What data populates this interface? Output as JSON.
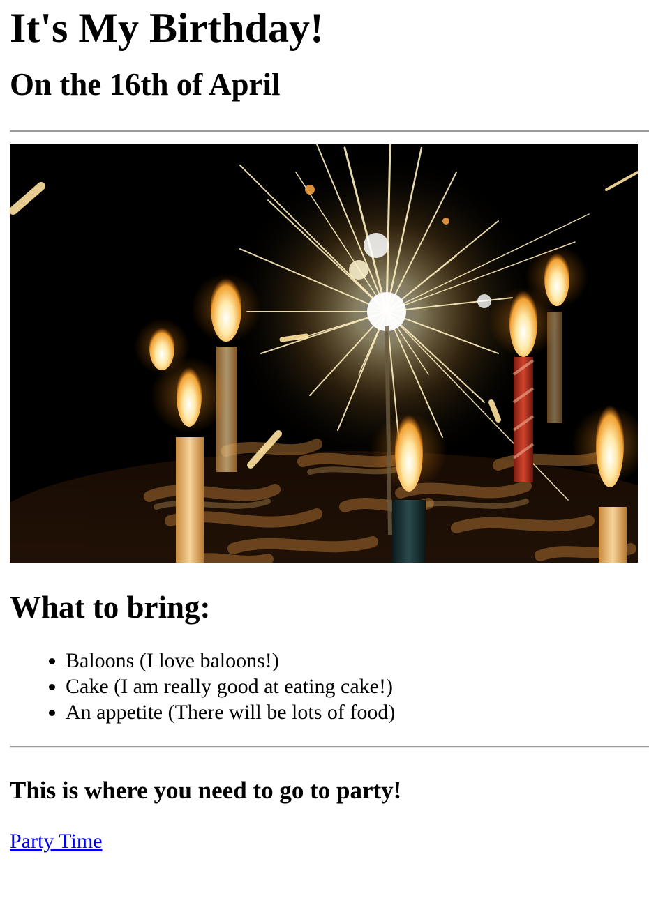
{
  "header": {
    "title": "It's My Birthday!",
    "subtitle": "On the 16th of April"
  },
  "hero": {
    "alt": "Birthday cake with lit candles and a sparkler",
    "colors": {
      "background": "#000000",
      "flame": "#ffd27a",
      "spark": "#fff3c4",
      "candle_red": "#c0392b",
      "icing": "#d7a35c"
    }
  },
  "bring": {
    "heading": "What to bring:",
    "items": [
      "Baloons (I love baloons!)",
      "Cake (I am really good at eating cake!)",
      "An appetite (There will be lots of food)"
    ]
  },
  "party": {
    "heading": "This is where you need to go to party!",
    "link_label": "Party Time"
  }
}
